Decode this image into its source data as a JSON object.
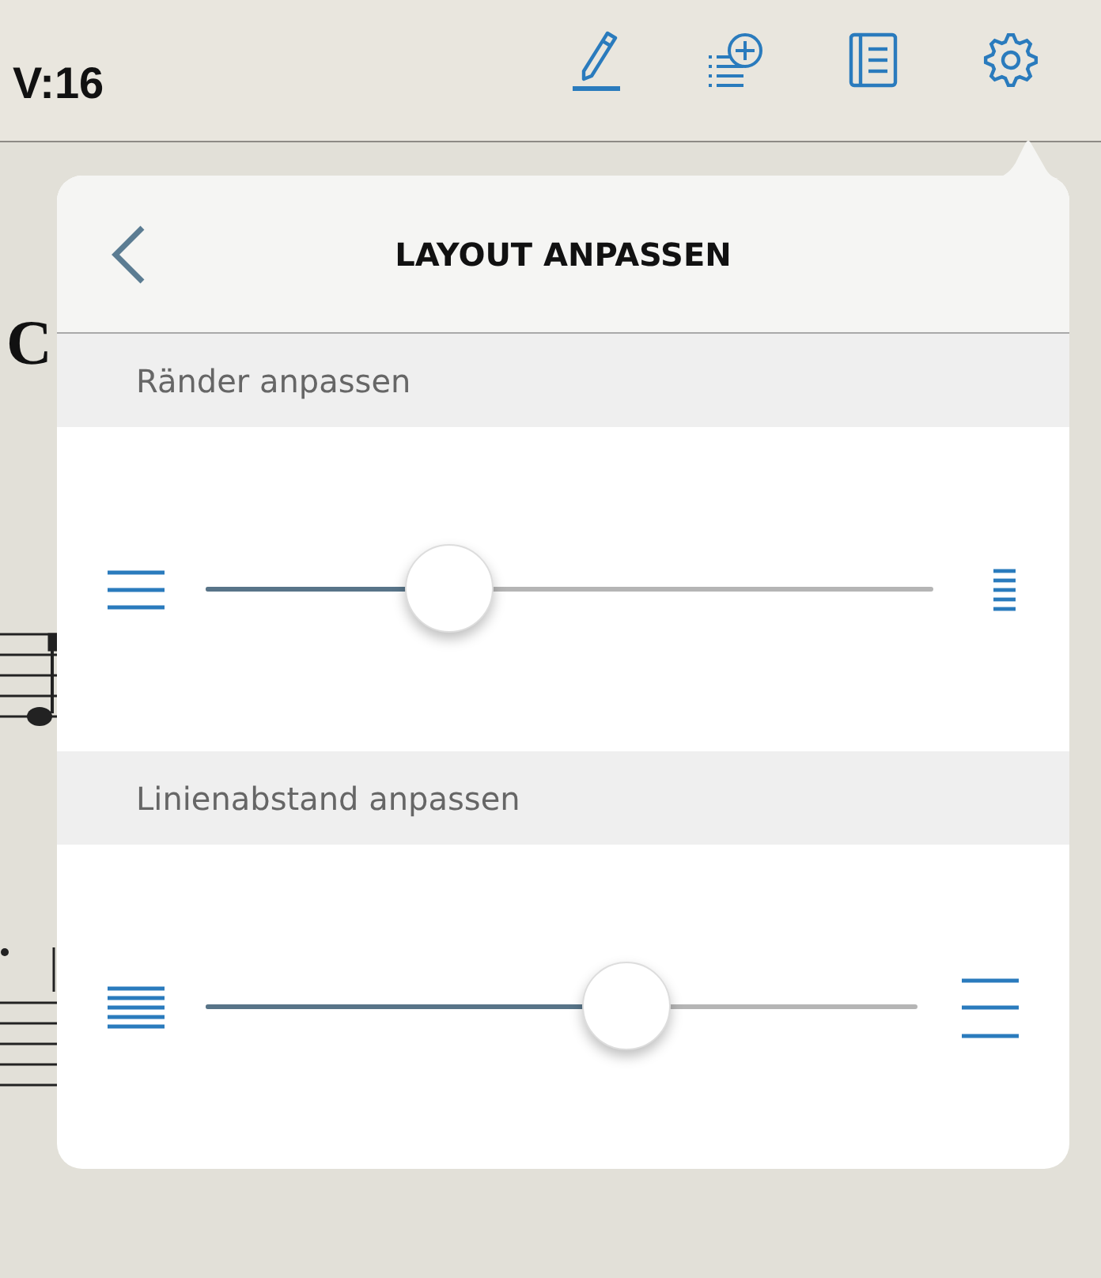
{
  "top_bar": {
    "version": "V:16"
  },
  "score": {
    "title_fragment": "C"
  },
  "popover": {
    "title": "LAYOUT ANPASSEN",
    "sections": [
      {
        "header": "Ränder anpassen",
        "kind": "margins",
        "level": 0.335
      },
      {
        "header": "Linienabstand anpassen",
        "kind": "spacing",
        "level": 0.59
      }
    ]
  }
}
